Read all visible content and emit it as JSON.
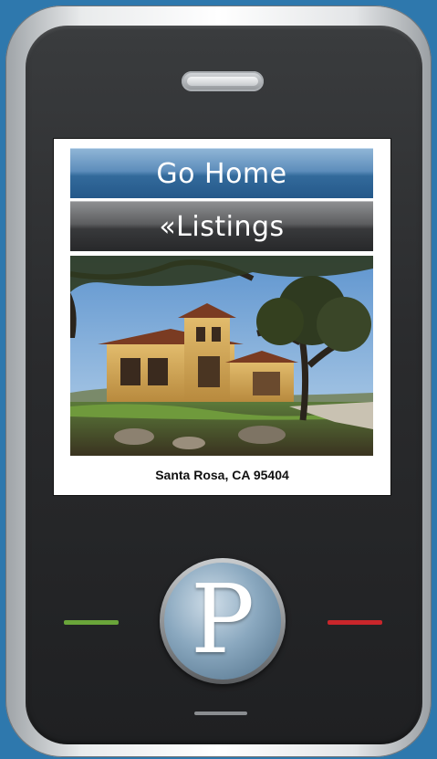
{
  "screen": {
    "buttons": {
      "go_home_label": "Go Home",
      "listings_label": "«Listings"
    },
    "listing": {
      "photo_icon": "house-photo",
      "caption": "Santa Rosa, CA 95404"
    }
  },
  "device": {
    "home_key_letter": "P",
    "left_key_color": "#6aa53a",
    "right_key_color": "#c9262b"
  }
}
